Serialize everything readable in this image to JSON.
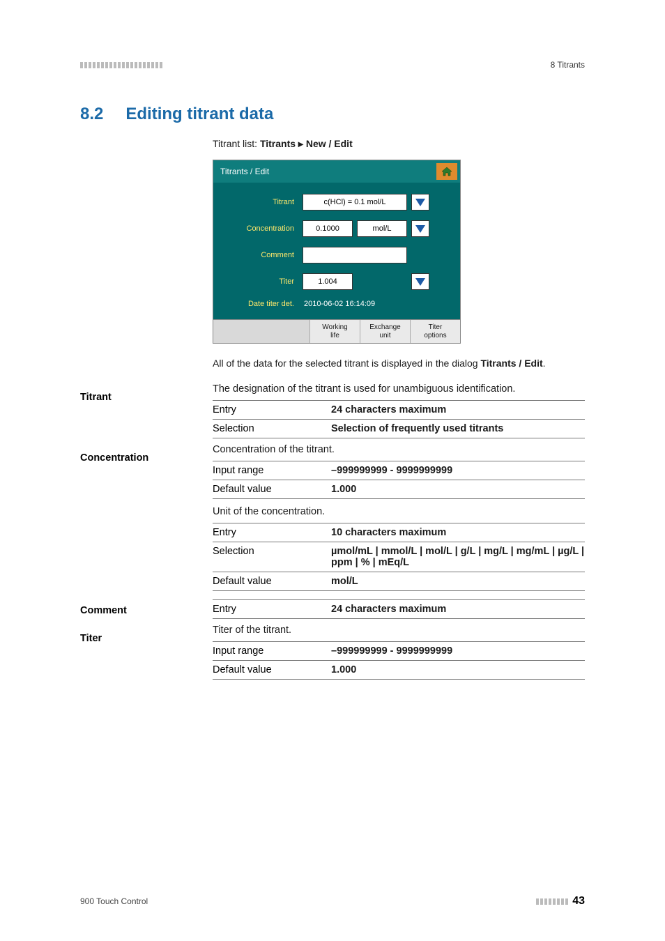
{
  "header": {
    "right": "8 Titrants"
  },
  "section": {
    "number": "8.2",
    "title": "Editing titrant data"
  },
  "breadcrumb": {
    "prefix": "Titrant list: ",
    "strong": "Titrants ▸ New / Edit"
  },
  "ui": {
    "titlebar": "Titrants / Edit",
    "rows": {
      "titrant": {
        "label": "Titrant",
        "value": "c(HCl) = 0.1 mol/L"
      },
      "concentration": {
        "label": "Concentration",
        "value": "0.1000",
        "unit": "mol/L"
      },
      "comment": {
        "label": "Comment",
        "value": ""
      },
      "titer": {
        "label": "Titer",
        "value": "1.004"
      },
      "date": {
        "label": "Date titer det.",
        "value": "2010-06-02 16:14:09"
      }
    },
    "buttons": {
      "working": "Working\nlife",
      "exchange": "Exchange\nunit",
      "titer": "Titer\noptions"
    }
  },
  "paragraph": {
    "p1a": "All of the data for the selected titrant is displayed in the dialog ",
    "p1b": "Titrants / Edit",
    "p1c": "."
  },
  "fields": {
    "titrant": {
      "head": "Titrant",
      "desc": "The designation of the titrant is used for unambiguous identification.",
      "rows": [
        {
          "k": "Entry",
          "v": "24 characters maximum"
        },
        {
          "k": "Selection",
          "v": "Selection of frequently used titrants"
        }
      ]
    },
    "concentration": {
      "head": "Concentration",
      "desc1": "Concentration of the titrant.",
      "rows1": [
        {
          "k": "Input range",
          "v": "–999999999 - 9999999999"
        },
        {
          "k": "Default value",
          "v": "1.000"
        }
      ],
      "desc2": "Unit of the concentration.",
      "rows2": [
        {
          "k": "Entry",
          "v": "10 characters maximum"
        },
        {
          "k": "Selection",
          "v": "µmol/mL | mmol/L | mol/L | g/L | mg/L | mg/mL | µg/L | ppm | % | mEq/L"
        },
        {
          "k": "Default value",
          "v": "mol/L"
        }
      ]
    },
    "comment": {
      "head": "Comment",
      "rows": [
        {
          "k": "Entry",
          "v": "24 characters maximum"
        }
      ]
    },
    "titer": {
      "head": "Titer",
      "desc": "Titer of the titrant.",
      "rows": [
        {
          "k": "Input range",
          "v": "–999999999 - 9999999999"
        },
        {
          "k": "Default value",
          "v": "1.000"
        }
      ]
    }
  },
  "footer": {
    "left": "900 Touch Control",
    "page": "43"
  }
}
